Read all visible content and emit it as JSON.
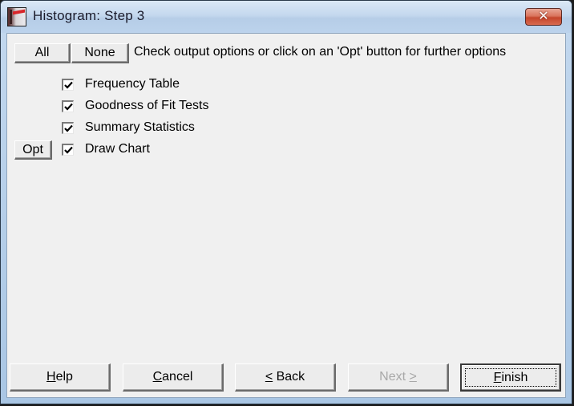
{
  "window": {
    "title": "Histogram: Step 3",
    "icon": "app-icon",
    "close_icon": "close-icon",
    "close_glyph": "✕"
  },
  "toolbar": {
    "all_label": "All",
    "none_label": "None",
    "hint": "Check output options or click on an 'Opt' button for further options"
  },
  "options": [
    {
      "label": "Frequency Table",
      "checked": true,
      "has_opt": false
    },
    {
      "label": "Goodness of Fit Tests",
      "checked": true,
      "has_opt": false
    },
    {
      "label": "Summary Statistics",
      "checked": true,
      "has_opt": false
    },
    {
      "label": "Draw Chart",
      "checked": true,
      "has_opt": true
    }
  ],
  "opt_label": "Opt",
  "footer": {
    "help": {
      "mnemonic": "H",
      "rest": "elp",
      "enabled": true
    },
    "cancel": {
      "mnemonic": "C",
      "rest": "ancel",
      "enabled": true
    },
    "back": {
      "prefix": "",
      "mnemonic": "<",
      "rest": " Back",
      "enabled": true
    },
    "next": {
      "prefix": "Next ",
      "mnemonic": ">",
      "rest": "",
      "enabled": false
    },
    "finish": {
      "mnemonic": "F",
      "rest": "inish",
      "enabled": true,
      "default": true
    }
  }
}
